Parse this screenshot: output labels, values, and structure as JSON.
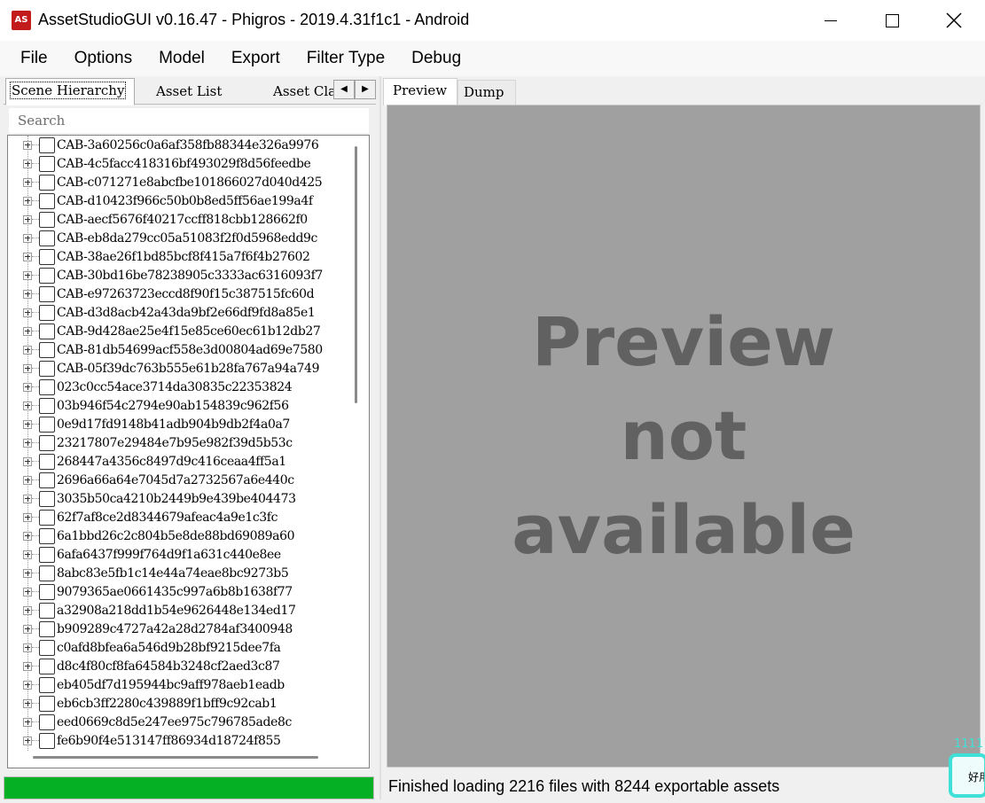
{
  "window": {
    "icon_text": "AS",
    "title": "AssetStudioGUI v0.16.47 - Phigros - 2019.4.31f1c1 - Android"
  },
  "menu": [
    "File",
    "Options",
    "Model",
    "Export",
    "Filter Type",
    "Debug"
  ],
  "left_tabs": {
    "scene_hierarchy": "Scene Hierarchy",
    "asset_list": "Asset List",
    "asset_classes": "Asset Classes",
    "arrow_left": "◀",
    "arrow_right": "▶"
  },
  "search": {
    "placeholder": "Search",
    "value": ""
  },
  "tree_items": [
    "CAB-3a60256c0a6af358fb88344e326a9976",
    "CAB-4c5facc418316bf493029f8d56feedbe",
    "CAB-c071271e8abcfbe101866027d040d425",
    "CAB-d10423f966c50b0b8ed5ff56ae199a4f",
    "CAB-aecf5676f40217ccff818cbb128662f0",
    "CAB-eb8da279cc05a51083f2f0d5968edd9c",
    "CAB-38ae26f1bd85bcf8f415a7f6f4b27602",
    "CAB-30bd16be78238905c3333ac6316093f7",
    "CAB-e97263723eccd8f90f15c387515fc60d",
    "CAB-d3d8acb42a43da9bf2e66df9fd8a85e1",
    "CAB-9d428ae25e4f15e85ce60ec61b12db27",
    "CAB-81db54699acf558e3d00804ad69e7580",
    "CAB-05f39dc763b555e61b28fa767a94a749",
    "023c0cc54ace3714da30835c22353824",
    "03b946f54c2794e90ab154839c962f56",
    "0e9d17fd9148b41adb904b9db2f4a0a7",
    "23217807e29484e7b95e982f39d5b53c",
    "268447a4356c8497d9c416ceaa4ff5a1",
    "2696a66a64e7045d7a2732567a6e440c",
    "3035b50ca4210b2449b9e439be404473",
    "62f7af8ce2d8344679afeac4a9e1c3fc",
    "6a1bbd26c2c804b5e8de88bd69089a60",
    "6afa6437f999f764d9f1a631c440e8ee",
    "8abc83e5fb1c14e44a74eae8bc9273b5",
    "9079365ae0661435c997a6b8b1638f77",
    "a32908a218dd1b54e9626448e134ed17",
    "b909289c4727a42a28d2784af3400948",
    "c0afd8bfea6a546d9b28bf9215dee7fa",
    "d8c4f80cf8fa64584b3248cf2aed3c87",
    "eb405df7d195944bc9aff978aeb1eadb",
    "eb6cb3ff2280c439889f1bff9c92cab1",
    "eed0669c8d5e247ee975c796785ade8c",
    "fe6b90f4e513147ff86934d18724f855"
  ],
  "progress": {
    "fraction": 1.0,
    "color": "#06b025"
  },
  "right_tabs": {
    "preview": "Preview",
    "dump": "Dump"
  },
  "preview": {
    "message_line1": "Preview",
    "message_line2": "not",
    "message_line3": "available"
  },
  "status": "Finished loading 2216 files with 8244 exportable assets",
  "overlay": {
    "label": "1111",
    "widget_text": "好用"
  },
  "colors": {
    "app_icon": "#c11b1b",
    "progress": "#06b025",
    "preview_bg": "#a0a0a0",
    "preview_text": "#616161"
  }
}
